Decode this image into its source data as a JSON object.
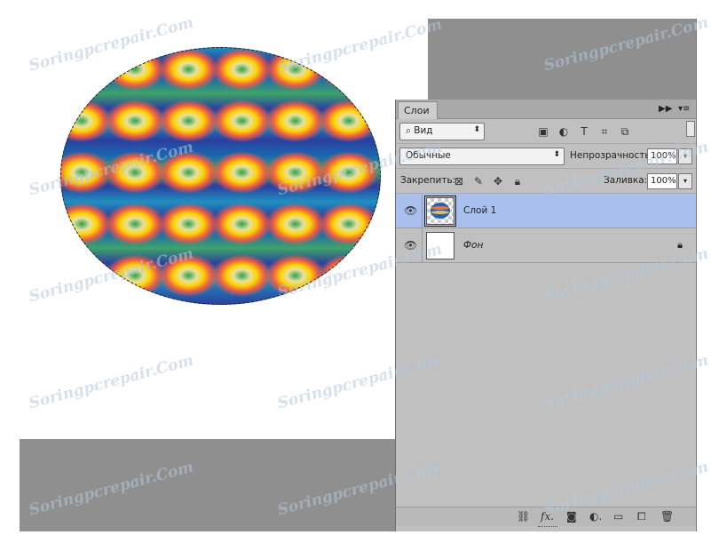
{
  "canvas": {
    "image_name": "patterned-ellipse",
    "stripe_colors": [
      "#1f8fbf",
      "#2b3f9e",
      "#1a66b0",
      "#3fa36a",
      "#8a3aa8"
    ],
    "blob_colors": [
      "#ff5a3c",
      "#ffd400",
      "#e9e0a0",
      "#2aa34a"
    ]
  },
  "panel": {
    "tab_label": "Слои",
    "filter_label": "Вид",
    "blend_mode": "Обычные",
    "opacity_label": "Непрозрачность:",
    "opacity_value": "100%",
    "lock_label": "Закрепить:",
    "fill_label": "Заливка:",
    "fill_value": "100%",
    "filter_icons": [
      "image-filter-icon",
      "adjustment-filter-icon",
      "type-filter-icon",
      "shape-filter-icon",
      "smart-object-filter-icon"
    ],
    "lock_icons": [
      "lock-transparency-icon",
      "lock-pixels-icon",
      "lock-position-icon",
      "lock-all-icon"
    ],
    "footer_icons": [
      "link-icon",
      "fx-icon",
      "mask-icon",
      "adjustment-icon",
      "group-folder-icon",
      "new-layer-icon",
      "trash-icon"
    ],
    "layers": [
      {
        "name": "Слой 1",
        "selected": true,
        "locked": false
      },
      {
        "name": "Фон",
        "selected": false,
        "locked": true
      }
    ]
  },
  "watermark": "Soringpcrepair.Com"
}
